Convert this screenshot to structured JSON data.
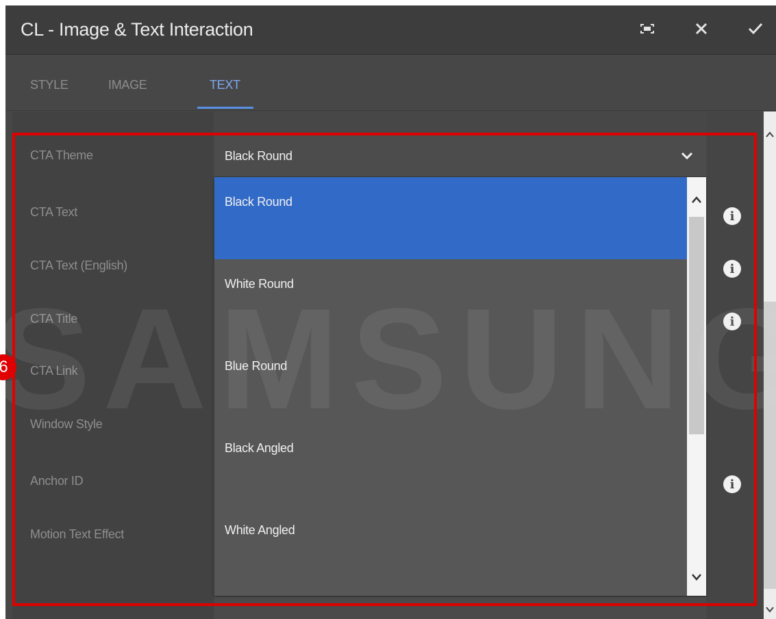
{
  "dialog": {
    "title": "CL - Image & Text Interaction"
  },
  "header_icons": [
    "fullscreen-icon",
    "close-icon",
    "checkmark-icon"
  ],
  "tabs": [
    {
      "label": "STYLE",
      "active": false
    },
    {
      "label": "IMAGE",
      "active": false
    },
    {
      "label": "TEXT",
      "active": true
    }
  ],
  "fields": [
    {
      "label": "CTA Theme",
      "info": false
    },
    {
      "label": "CTA Text",
      "info": true
    },
    {
      "label": "CTA Text (English)",
      "info": true
    },
    {
      "label": "CTA Title",
      "info": true
    },
    {
      "label": "CTA Link",
      "info": false
    },
    {
      "label": "Window Style",
      "info": false
    },
    {
      "label": "Anchor ID",
      "info": true
    },
    {
      "label": "Motion Text Effect",
      "info": false
    }
  ],
  "cta_theme": {
    "selected": "Black Round",
    "options": [
      "Black Round",
      "White Round",
      "Blue Round",
      "Black Angled",
      "White Angled"
    ]
  },
  "watermark": "SAMSUNG",
  "annotation": {
    "step": "6"
  },
  "colors": {
    "accent": "#326ac7",
    "tab_active": "#7da8ee",
    "annotation": "#e00000"
  }
}
